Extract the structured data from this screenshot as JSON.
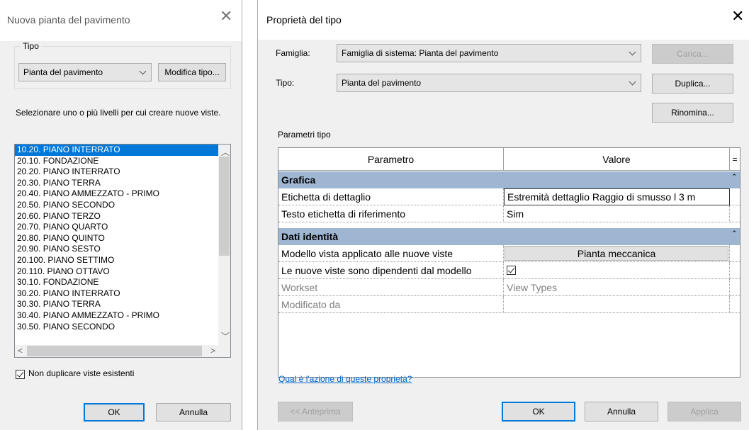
{
  "left_dialog": {
    "title": "Nuova pianta del pavimento",
    "group_label": "Tipo",
    "type_value": "Pianta del pavimento",
    "edit_type_button": "Modifica tipo...",
    "instruction": "Selezionare uno o più livelli per cui creare nuove viste.",
    "levels": [
      "10.20. PIANO INTERRATO",
      "20.10. FONDAZIONE",
      "20.20. PIANO INTERRATO",
      "20.30. PIANO TERRA",
      "20.40. PIANO AMMEZZATO - PRIMO",
      "20.50. PIANO SECONDO",
      "20.60. PIANO TERZO",
      "20.70. PIANO QUARTO",
      "20.80. PIANO QUINTO",
      "20.90. PIANO SESTO",
      "20.100. PIANO SETTIMO",
      "20.110. PIANO OTTAVO",
      "30.10. FONDAZIONE",
      "30.20. PIANO INTERRATO",
      "30.30. PIANO TERRA",
      "30.40. PIANO AMMEZZATO - PRIMO",
      "30.50. PIANO SECONDO"
    ],
    "selected_level": "10.20. PIANO INTERRATO",
    "no_duplicate_label": "Non duplicare viste esistenti",
    "no_duplicate_checked": true,
    "ok": "OK",
    "cancel": "Annulla"
  },
  "right_dialog": {
    "title": "Proprietà del tipo",
    "family_label": "Famiglia:",
    "family_value": "Famiglia di sistema: Pianta del pavimento",
    "type_label": "Tipo:",
    "type_value": "Pianta del pavimento",
    "load_button": "Carica...",
    "duplicate_button": "Duplica...",
    "rename_button": "Rinomina...",
    "params_label": "Parametri tipo",
    "col_param": "Parametro",
    "col_value": "Valore",
    "col_eq": "=",
    "sections": [
      {
        "name": "Grafica",
        "rows": [
          {
            "param": "Etichetta di dettaglio",
            "value": "Estremità dettaglio Raggio di smusso l 3 m"
          },
          {
            "param": "Testo etichetta di riferimento",
            "value": "Sim"
          }
        ]
      },
      {
        "name": "Dati identità",
        "rows": [
          {
            "param": "Modello vista applicato alle nuove viste",
            "value": "Pianta meccanica"
          },
          {
            "param": "Le nuove viste sono dipendenti dal modello",
            "value": ""
          },
          {
            "param": "Workset",
            "value": "View Types"
          },
          {
            "param": "Modificato da",
            "value": ""
          }
        ]
      }
    ],
    "dependent_checked": true,
    "help_link": "Qual è l'azione di queste proprietà?",
    "preview_button": "<< Anteprima",
    "ok": "OK",
    "cancel": "Annulla",
    "apply": "Applica"
  },
  "colors": {
    "accent": "#0078d7",
    "section_header": "#9fb6d2",
    "link": "#0066cc"
  }
}
